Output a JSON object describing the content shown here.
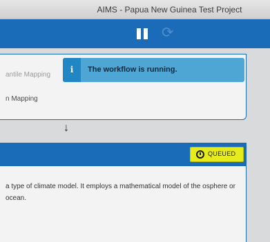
{
  "window": {
    "title": "AIMS - Papua New Guinea Test Project"
  },
  "toolbar": {
    "pause_icon": "pause-icon",
    "refresh_icon": "refresh-icon"
  },
  "canvas": {
    "node1": {
      "faded_label": "antile Mapping",
      "label": "n Mapping"
    },
    "toast": {
      "icon": "info-icon",
      "icon_glyph": "i",
      "message": "The workflow is running."
    },
    "arrow": "↓",
    "node2": {
      "status": "QUEUED",
      "status_icon": "clock-icon",
      "description": "a type of climate model. It employs a mathematical model of the osphere or ocean."
    }
  },
  "colors": {
    "toolbar": "#1a6bb8",
    "toast": "#4da6d4",
    "badge": "#e6eb1c",
    "canvas": "#d9dadb"
  }
}
